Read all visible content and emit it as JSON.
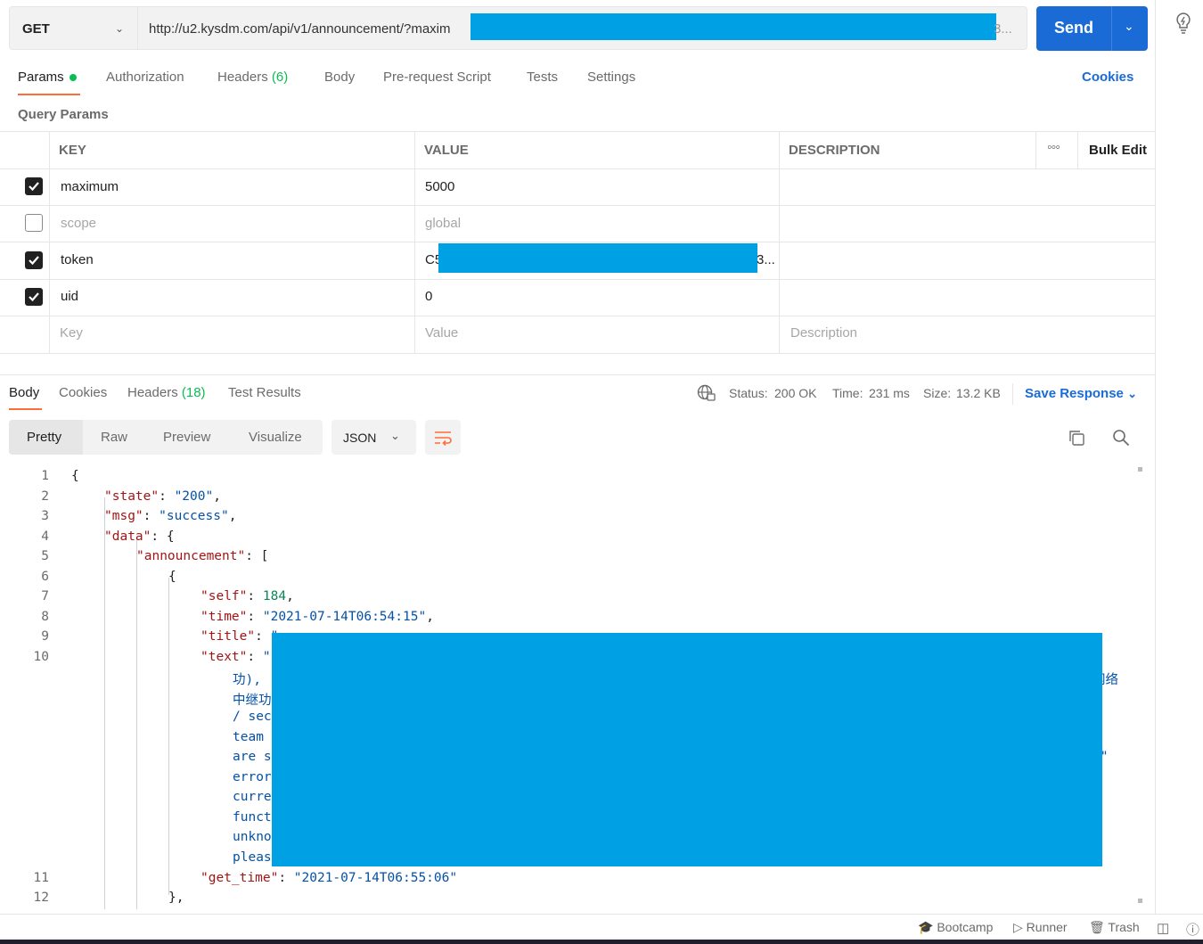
{
  "request": {
    "method": "GET",
    "url_visible": "http://u2.kysdm.com/api/v1/announcement/?maxim",
    "url_tail": "3...",
    "send_label": "Send"
  },
  "tabs": {
    "params": "Params",
    "authorization": "Authorization",
    "headers": "Headers",
    "headers_count": "(6)",
    "body": "Body",
    "prerequest": "Pre-request Script",
    "tests": "Tests",
    "settings": "Settings",
    "cookies": "Cookies"
  },
  "query_params": {
    "title": "Query Params",
    "headers": {
      "key": "KEY",
      "value": "VALUE",
      "description": "DESCRIPTION",
      "bulk_edit": "Bulk Edit"
    },
    "rows": [
      {
        "checked": true,
        "key": "maximum",
        "value": "5000"
      },
      {
        "checked": false,
        "key": "scope",
        "value": "global"
      },
      {
        "checked": true,
        "key": "token",
        "value_start": "C5",
        "value_end": "3..."
      },
      {
        "checked": true,
        "key": "uid",
        "value": "0"
      }
    ],
    "placeholders": {
      "key": "Key",
      "value": "Value",
      "description": "Description"
    }
  },
  "response": {
    "tabs": {
      "body": "Body",
      "cookies": "Cookies",
      "headers": "Headers",
      "headers_count": "(18)",
      "test_results": "Test Results"
    },
    "status_label": "Status:",
    "status_value": "200 OK",
    "time_label": "Time:",
    "time_value": "231 ms",
    "size_label": "Size:",
    "size_value": "13.2 KB",
    "save_response": "Save Response",
    "view_modes": [
      "Pretty",
      "Raw",
      "Preview",
      "Visualize"
    ],
    "format": "JSON"
  },
  "code_lines": {
    "l1": "{",
    "l2_key": "\"state\"",
    "l2_val": "\"200\"",
    "l3_key": "\"msg\"",
    "l3_val": "\"success\"",
    "l4_key": "\"data\"",
    "l4_rest": ": {",
    "l5_key": "\"announcement\"",
    "l5_rest": ": [",
    "l6": "{",
    "l7_key": "\"self\"",
    "l7_val": "184",
    "l8_key": "\"time\"",
    "l8_val": "\"2021-07-14T06:54:15\"",
    "l9_key": "\"title\"",
    "l9_val": "\"",
    "l10_key": "\"text\"",
    "l10_val": "\"",
    "wrap": [
      "功),",
      "中继功",
      "/ sec",
      "team",
      "are s",
      "error",
      "curre",
      "funct",
      "unkno",
      "pleas"
    ],
    "wrap_right": [
      "网络",
      "",
      "",
      "",
      "\\\"",
      "",
      "",
      "",
      "",
      ""
    ],
    "l11_key": "\"get_time\"",
    "l11_val": "\"2021-07-14T06:55:06\"",
    "l12": "},",
    "line_numbers": [
      "1",
      "2",
      "3",
      "4",
      "5",
      "6",
      "7",
      "8",
      "9",
      "10",
      "11",
      "12"
    ]
  },
  "footer": {
    "bootcamp": "Bootcamp",
    "runner": "Runner",
    "trash": "Trash"
  }
}
